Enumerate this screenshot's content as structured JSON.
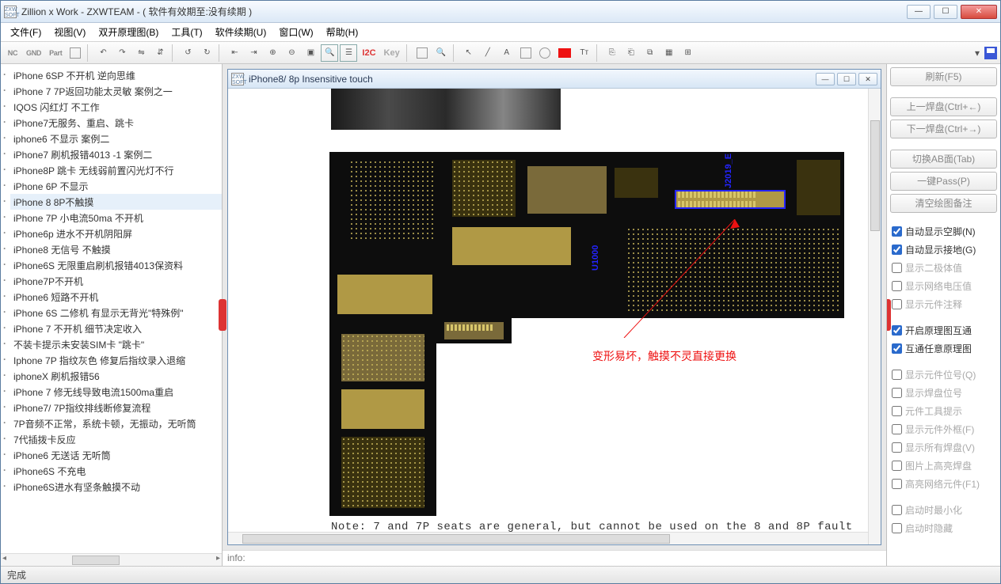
{
  "window": {
    "title": "Zillion x Work - ZXWTEAM - ( 软件有效期至:没有续期 )"
  },
  "menu": [
    "文件(F)",
    "视图(V)",
    "双开原理图(B)",
    "工具(T)",
    "软件续期(U)",
    "窗口(W)",
    "帮助(H)"
  ],
  "toolbar1": {
    "nc": "NC",
    "gnd": "GND",
    "part": "Part",
    "i2c": "I2C",
    "key": "Key"
  },
  "tree": [
    "iPhone 6SP 不开机 逆向思维",
    "iPhone 7 7P返回功能太灵敏 案例之一",
    "IQOS 闪红灯 不工作",
    "iPhone7无服务、重启、跳卡",
    "iphone6 不显示 案例二",
    "iPhone7 刷机报错4013 -1 案例二",
    "iPhone8P 跳卡 无线弱前置闪光灯不行",
    "iPhone 6P 不显示",
    "iPhone 8 8P不触摸",
    "iPhone 7P 小电流50ma 不开机",
    "iPhone6p 进水不开机阴阳屏",
    "iPhone8 无信号 不触摸",
    "iPhone6S 无限重启刷机报错4013保资料",
    "iPhone7P不开机",
    "iPhone6 短路不开机",
    "iPhone 6S 二修机 有显示无背光\"特殊例\"",
    "iPhone 7 不开机 细节决定收入",
    "不装卡提示未安装SIM卡 \"跳卡\"",
    "Iphone 7P 指纹灰色  修复后指纹录入退缩",
    "iphoneX 刷机报错56",
    "iPhone 7 修无线导致电流1500ma重启",
    "iPhone7/ 7P指纹排线断修复流程",
    "7P音频不正常，系统卡顿，无振动，无听筒",
    "7代插拨卡反应",
    "iPhone6 无送话 无听筒",
    "iPhone6S 不充电",
    "iPhone6S进水有坚条触摸不动"
  ],
  "inner": {
    "title": "iPhone8/ 8p Insensitive touch",
    "label_u1": "U1000",
    "label_u2": "J2019_E",
    "annotation": "变形易坏，触摸不灵直接更换",
    "note": "Note: 7 and 7P seats are general, but cannot be used on the 8 and 8P fault"
  },
  "infoBar": "info:",
  "right": {
    "buttons": [
      "刷新(F5)",
      "上一焊盘(Ctrl+←)",
      "下一焊盘(Ctrl+→)",
      "切换AB面(Tab)",
      "一键Pass(P)",
      "清空绘图备注"
    ],
    "group1": [
      {
        "label": "自动显示空脚(N)",
        "on": true
      },
      {
        "label": "自动显示接地(G)",
        "on": true
      },
      {
        "label": "显示二极体值",
        "on": false
      },
      {
        "label": "显示网络电压值",
        "on": false
      },
      {
        "label": "显示元件注释",
        "on": false
      }
    ],
    "group2": [
      {
        "label": "开启原理图互通",
        "on": true
      },
      {
        "label": "互通任意原理图",
        "on": true
      }
    ],
    "group3": [
      {
        "label": "显示元件位号(Q)",
        "on": false
      },
      {
        "label": "显示焊盘位号",
        "on": false
      },
      {
        "label": "元件工具提示",
        "on": false
      },
      {
        "label": "显示元件外框(F)",
        "on": false
      },
      {
        "label": "显示所有焊盘(V)",
        "on": false
      },
      {
        "label": "图片上高亮焊盘",
        "on": false
      },
      {
        "label": "高亮网络元件(F1)",
        "on": false
      }
    ],
    "group4": [
      {
        "label": "启动时最小化",
        "on": false
      },
      {
        "label": "启动时隐藏",
        "on": false
      }
    ]
  },
  "status": "完成"
}
